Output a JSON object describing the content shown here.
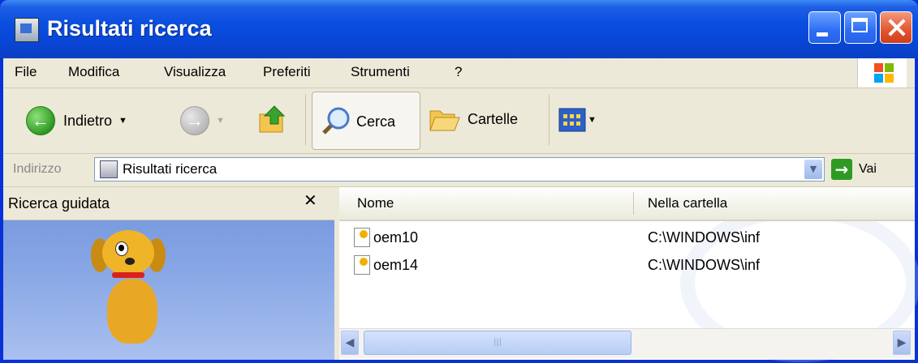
{
  "window": {
    "title": "Risultati ricerca"
  },
  "menu": {
    "items": [
      "File",
      "Modifica",
      "Visualizza",
      "Preferiti",
      "Strumenti",
      "?"
    ]
  },
  "toolbar": {
    "back_label": "Indietro",
    "search_label": "Cerca",
    "folders_label": "Cartelle"
  },
  "address": {
    "label": "Indirizzo",
    "value": "Risultati ricerca",
    "go_label": "Vai"
  },
  "left_pane": {
    "title": "Ricerca guidata",
    "close_glyph": "✕"
  },
  "results": {
    "columns": [
      "Nome",
      "Nella cartella"
    ],
    "rows": [
      {
        "name": "oem10",
        "folder": "C:\\WINDOWS\\inf"
      },
      {
        "name": "oem14",
        "folder": "C:\\WINDOWS\\inf"
      }
    ]
  },
  "colors": {
    "title_bar": "#0a4ee0",
    "chrome": "#ece9d8",
    "assistant_bg": "#8aa8e6",
    "close_button": "#e2552e"
  }
}
